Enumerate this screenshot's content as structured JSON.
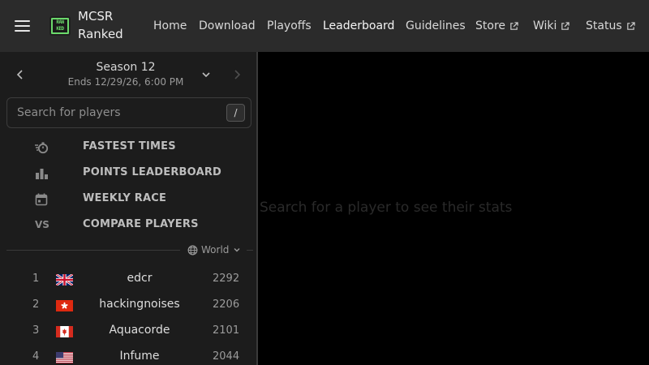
{
  "topbar": {
    "brand_line1": "MCSR",
    "brand_line2": "Ranked",
    "logo_text_top": "RAN",
    "logo_text_bottom": "KED",
    "nav": {
      "home": "Home",
      "download": "Download",
      "playoffs": "Playoffs",
      "leaderboard": "Leaderboard",
      "guidelines": "Guidelines",
      "store": "Store",
      "wiki": "Wiki",
      "status": "Status"
    },
    "active_nav": "Leaderboard"
  },
  "sidebar": {
    "season": {
      "title": "Season 12",
      "ends": "Ends 12/29/26, 6:00 PM"
    },
    "search": {
      "placeholder": "Search for players",
      "shortcut": "/"
    },
    "menu": [
      {
        "label": "FASTEST TIMES",
        "icon": "stopwatch-icon"
      },
      {
        "label": "POINTS LEADERBOARD",
        "icon": "bar-chart-icon"
      },
      {
        "label": "WEEKLY RACE",
        "icon": "calendar-icon"
      },
      {
        "label": "COMPARE PLAYERS",
        "icon": "vs-icon",
        "icon_text": "VS"
      }
    ],
    "region": "World",
    "leaderboard": [
      {
        "rank": "1",
        "flag": "uk-flag",
        "name": "edcr",
        "points": "2292"
      },
      {
        "rank": "2",
        "flag": "hong-kong-flag",
        "name": "hackingnoises",
        "points": "2206"
      },
      {
        "rank": "3",
        "flag": "canada-flag",
        "name": "Aquacorde",
        "points": "2101"
      },
      {
        "rank": "4",
        "flag": "usa-flag",
        "name": "Infume",
        "points": "2044"
      }
    ]
  },
  "main": {
    "hint": "Search for a player to see their stats"
  },
  "colors": {
    "topbar": "#2b2b2b",
    "sidebar": "#1c1c1c",
    "main": "#000000",
    "logo_green": "#6bd96b"
  }
}
